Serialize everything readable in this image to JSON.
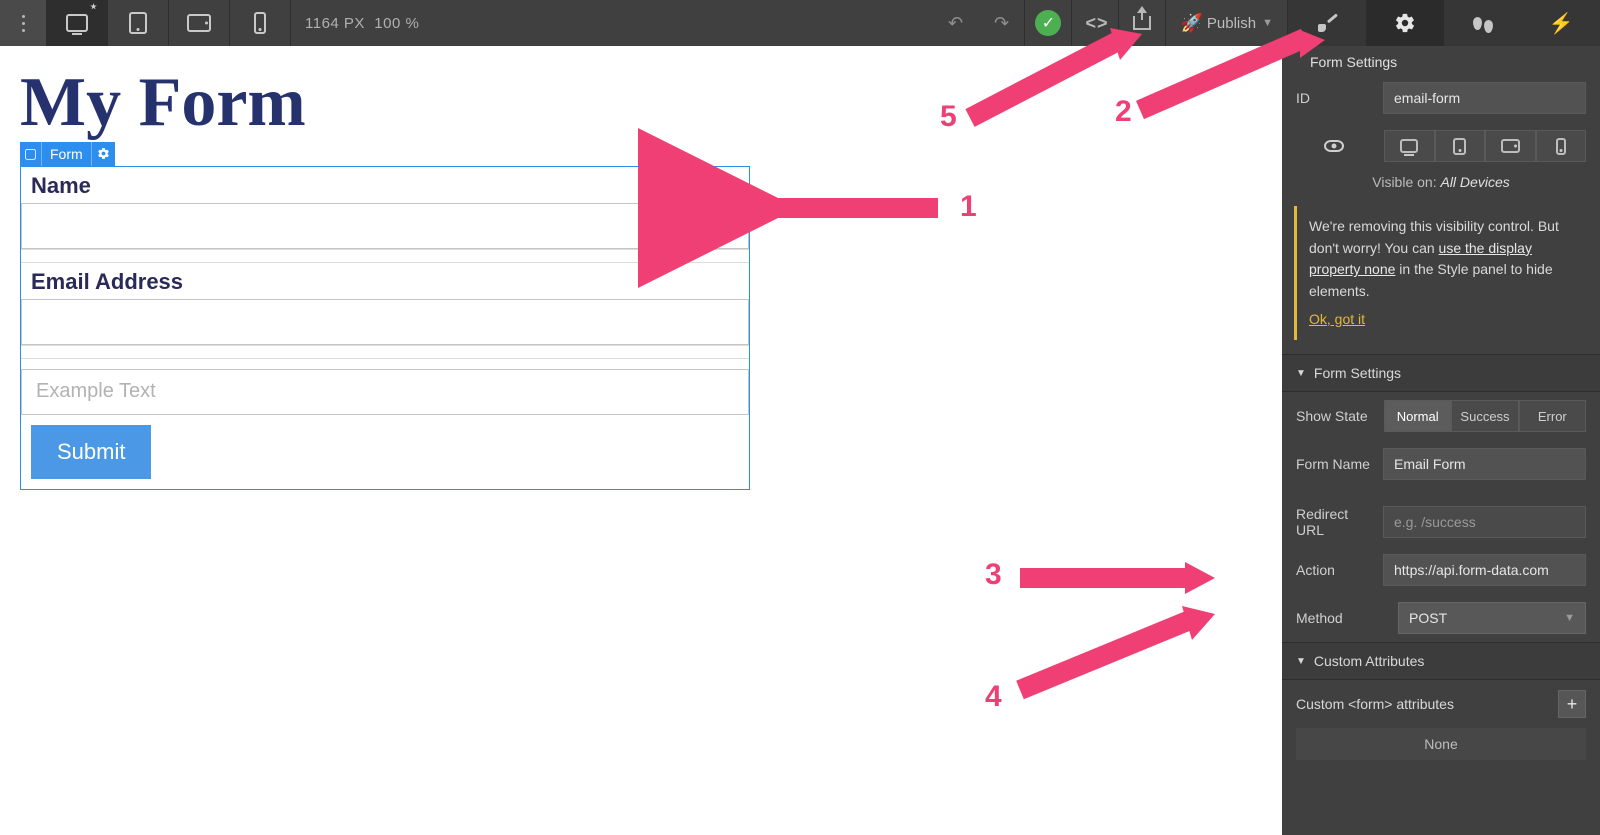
{
  "toolbar": {
    "width_px": "1164 PX",
    "zoom": "100 %",
    "publish_label": "Publish"
  },
  "canvas": {
    "title": "My Form",
    "selection_label": "Form",
    "name_label": "Name",
    "email_label": "Email Address",
    "example_placeholder": "Example Text",
    "submit_label": "Submit"
  },
  "panel": {
    "header_title": "Form Settings",
    "id_label": "ID",
    "id_value": "email-form",
    "visible_on_label": "Visible on:",
    "visible_on_value": "All Devices",
    "notice_line1": "We're removing this visibility control. But don't worry! You can ",
    "notice_link1": "use the display property none",
    "notice_line2": " in the Style panel to hide elements.",
    "notice_ok": "Ok, got it",
    "form_settings_title": "Form Settings",
    "show_state_label": "Show State",
    "state_normal": "Normal",
    "state_success": "Success",
    "state_error": "Error",
    "form_name_label": "Form Name",
    "form_name_value": "Email Form",
    "redirect_label": "Redirect URL",
    "redirect_placeholder": "e.g. /success",
    "action_label": "Action",
    "action_value": "https://api.form-data.com",
    "method_label": "Method",
    "method_value": "POST",
    "custom_attr_title": "Custom Attributes",
    "custom_form_label": "Custom <form> attributes",
    "none_label": "None"
  },
  "annotations": {
    "a1": "1",
    "a2": "2",
    "a3": "3",
    "a4": "4",
    "a5": "5"
  }
}
